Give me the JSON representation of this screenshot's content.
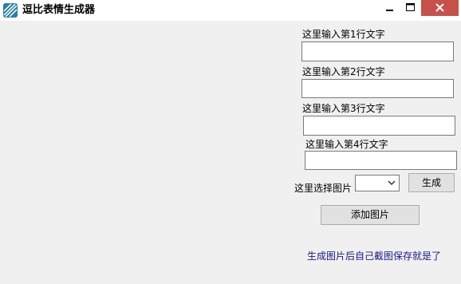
{
  "window": {
    "title": "逗比表情生成器"
  },
  "form": {
    "line1_label": "这里输入第1行文字",
    "line2_label": "这里输入第2行文字",
    "line3_label": "这里输入第3行文字",
    "line4_label": "这里输入第4行文字",
    "line1_value": "",
    "line2_value": "",
    "line3_value": "",
    "line4_value": "",
    "image_select_label": "这里选择图片",
    "image_select_value": "",
    "generate_button": "生成",
    "add_image_button": "添加图片",
    "hint_text": "生成图片后自己截图保存就是了"
  },
  "colors": {
    "close_button": "#c7504a",
    "hint_text": "#1a1a8c",
    "window_bg": "#f0f0f0"
  }
}
